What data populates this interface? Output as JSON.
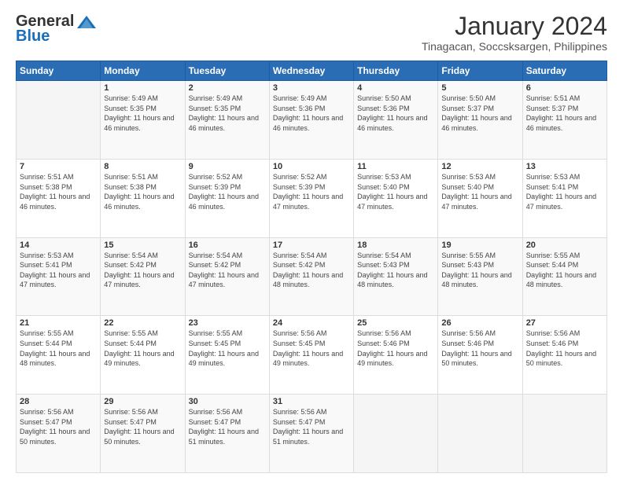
{
  "logo": {
    "general": "General",
    "blue": "Blue"
  },
  "title": "January 2024",
  "location": "Tinagacan, Soccsksargen, Philippines",
  "days_of_week": [
    "Sunday",
    "Monday",
    "Tuesday",
    "Wednesday",
    "Thursday",
    "Friday",
    "Saturday"
  ],
  "weeks": [
    [
      {
        "day": "",
        "sunrise": "",
        "sunset": "",
        "daylight": "",
        "empty": true
      },
      {
        "day": "1",
        "sunrise": "Sunrise: 5:49 AM",
        "sunset": "Sunset: 5:35 PM",
        "daylight": "Daylight: 11 hours and 46 minutes."
      },
      {
        "day": "2",
        "sunrise": "Sunrise: 5:49 AM",
        "sunset": "Sunset: 5:35 PM",
        "daylight": "Daylight: 11 hours and 46 minutes."
      },
      {
        "day": "3",
        "sunrise": "Sunrise: 5:49 AM",
        "sunset": "Sunset: 5:36 PM",
        "daylight": "Daylight: 11 hours and 46 minutes."
      },
      {
        "day": "4",
        "sunrise": "Sunrise: 5:50 AM",
        "sunset": "Sunset: 5:36 PM",
        "daylight": "Daylight: 11 hours and 46 minutes."
      },
      {
        "day": "5",
        "sunrise": "Sunrise: 5:50 AM",
        "sunset": "Sunset: 5:37 PM",
        "daylight": "Daylight: 11 hours and 46 minutes."
      },
      {
        "day": "6",
        "sunrise": "Sunrise: 5:51 AM",
        "sunset": "Sunset: 5:37 PM",
        "daylight": "Daylight: 11 hours and 46 minutes."
      }
    ],
    [
      {
        "day": "7",
        "sunrise": "Sunrise: 5:51 AM",
        "sunset": "Sunset: 5:38 PM",
        "daylight": "Daylight: 11 hours and 46 minutes."
      },
      {
        "day": "8",
        "sunrise": "Sunrise: 5:51 AM",
        "sunset": "Sunset: 5:38 PM",
        "daylight": "Daylight: 11 hours and 46 minutes."
      },
      {
        "day": "9",
        "sunrise": "Sunrise: 5:52 AM",
        "sunset": "Sunset: 5:39 PM",
        "daylight": "Daylight: 11 hours and 46 minutes."
      },
      {
        "day": "10",
        "sunrise": "Sunrise: 5:52 AM",
        "sunset": "Sunset: 5:39 PM",
        "daylight": "Daylight: 11 hours and 47 minutes."
      },
      {
        "day": "11",
        "sunrise": "Sunrise: 5:53 AM",
        "sunset": "Sunset: 5:40 PM",
        "daylight": "Daylight: 11 hours and 47 minutes."
      },
      {
        "day": "12",
        "sunrise": "Sunrise: 5:53 AM",
        "sunset": "Sunset: 5:40 PM",
        "daylight": "Daylight: 11 hours and 47 minutes."
      },
      {
        "day": "13",
        "sunrise": "Sunrise: 5:53 AM",
        "sunset": "Sunset: 5:41 PM",
        "daylight": "Daylight: 11 hours and 47 minutes."
      }
    ],
    [
      {
        "day": "14",
        "sunrise": "Sunrise: 5:53 AM",
        "sunset": "Sunset: 5:41 PM",
        "daylight": "Daylight: 11 hours and 47 minutes."
      },
      {
        "day": "15",
        "sunrise": "Sunrise: 5:54 AM",
        "sunset": "Sunset: 5:42 PM",
        "daylight": "Daylight: 11 hours and 47 minutes."
      },
      {
        "day": "16",
        "sunrise": "Sunrise: 5:54 AM",
        "sunset": "Sunset: 5:42 PM",
        "daylight": "Daylight: 11 hours and 47 minutes."
      },
      {
        "day": "17",
        "sunrise": "Sunrise: 5:54 AM",
        "sunset": "Sunset: 5:42 PM",
        "daylight": "Daylight: 11 hours and 48 minutes."
      },
      {
        "day": "18",
        "sunrise": "Sunrise: 5:54 AM",
        "sunset": "Sunset: 5:43 PM",
        "daylight": "Daylight: 11 hours and 48 minutes."
      },
      {
        "day": "19",
        "sunrise": "Sunrise: 5:55 AM",
        "sunset": "Sunset: 5:43 PM",
        "daylight": "Daylight: 11 hours and 48 minutes."
      },
      {
        "day": "20",
        "sunrise": "Sunrise: 5:55 AM",
        "sunset": "Sunset: 5:44 PM",
        "daylight": "Daylight: 11 hours and 48 minutes."
      }
    ],
    [
      {
        "day": "21",
        "sunrise": "Sunrise: 5:55 AM",
        "sunset": "Sunset: 5:44 PM",
        "daylight": "Daylight: 11 hours and 48 minutes."
      },
      {
        "day": "22",
        "sunrise": "Sunrise: 5:55 AM",
        "sunset": "Sunset: 5:44 PM",
        "daylight": "Daylight: 11 hours and 49 minutes."
      },
      {
        "day": "23",
        "sunrise": "Sunrise: 5:55 AM",
        "sunset": "Sunset: 5:45 PM",
        "daylight": "Daylight: 11 hours and 49 minutes."
      },
      {
        "day": "24",
        "sunrise": "Sunrise: 5:56 AM",
        "sunset": "Sunset: 5:45 PM",
        "daylight": "Daylight: 11 hours and 49 minutes."
      },
      {
        "day": "25",
        "sunrise": "Sunrise: 5:56 AM",
        "sunset": "Sunset: 5:46 PM",
        "daylight": "Daylight: 11 hours and 49 minutes."
      },
      {
        "day": "26",
        "sunrise": "Sunrise: 5:56 AM",
        "sunset": "Sunset: 5:46 PM",
        "daylight": "Daylight: 11 hours and 50 minutes."
      },
      {
        "day": "27",
        "sunrise": "Sunrise: 5:56 AM",
        "sunset": "Sunset: 5:46 PM",
        "daylight": "Daylight: 11 hours and 50 minutes."
      }
    ],
    [
      {
        "day": "28",
        "sunrise": "Sunrise: 5:56 AM",
        "sunset": "Sunset: 5:47 PM",
        "daylight": "Daylight: 11 hours and 50 minutes."
      },
      {
        "day": "29",
        "sunrise": "Sunrise: 5:56 AM",
        "sunset": "Sunset: 5:47 PM",
        "daylight": "Daylight: 11 hours and 50 minutes."
      },
      {
        "day": "30",
        "sunrise": "Sunrise: 5:56 AM",
        "sunset": "Sunset: 5:47 PM",
        "daylight": "Daylight: 11 hours and 51 minutes."
      },
      {
        "day": "31",
        "sunrise": "Sunrise: 5:56 AM",
        "sunset": "Sunset: 5:47 PM",
        "daylight": "Daylight: 11 hours and 51 minutes."
      },
      {
        "day": "",
        "sunrise": "",
        "sunset": "",
        "daylight": "",
        "empty": true
      },
      {
        "day": "",
        "sunrise": "",
        "sunset": "",
        "daylight": "",
        "empty": true
      },
      {
        "day": "",
        "sunrise": "",
        "sunset": "",
        "daylight": "",
        "empty": true
      }
    ]
  ]
}
